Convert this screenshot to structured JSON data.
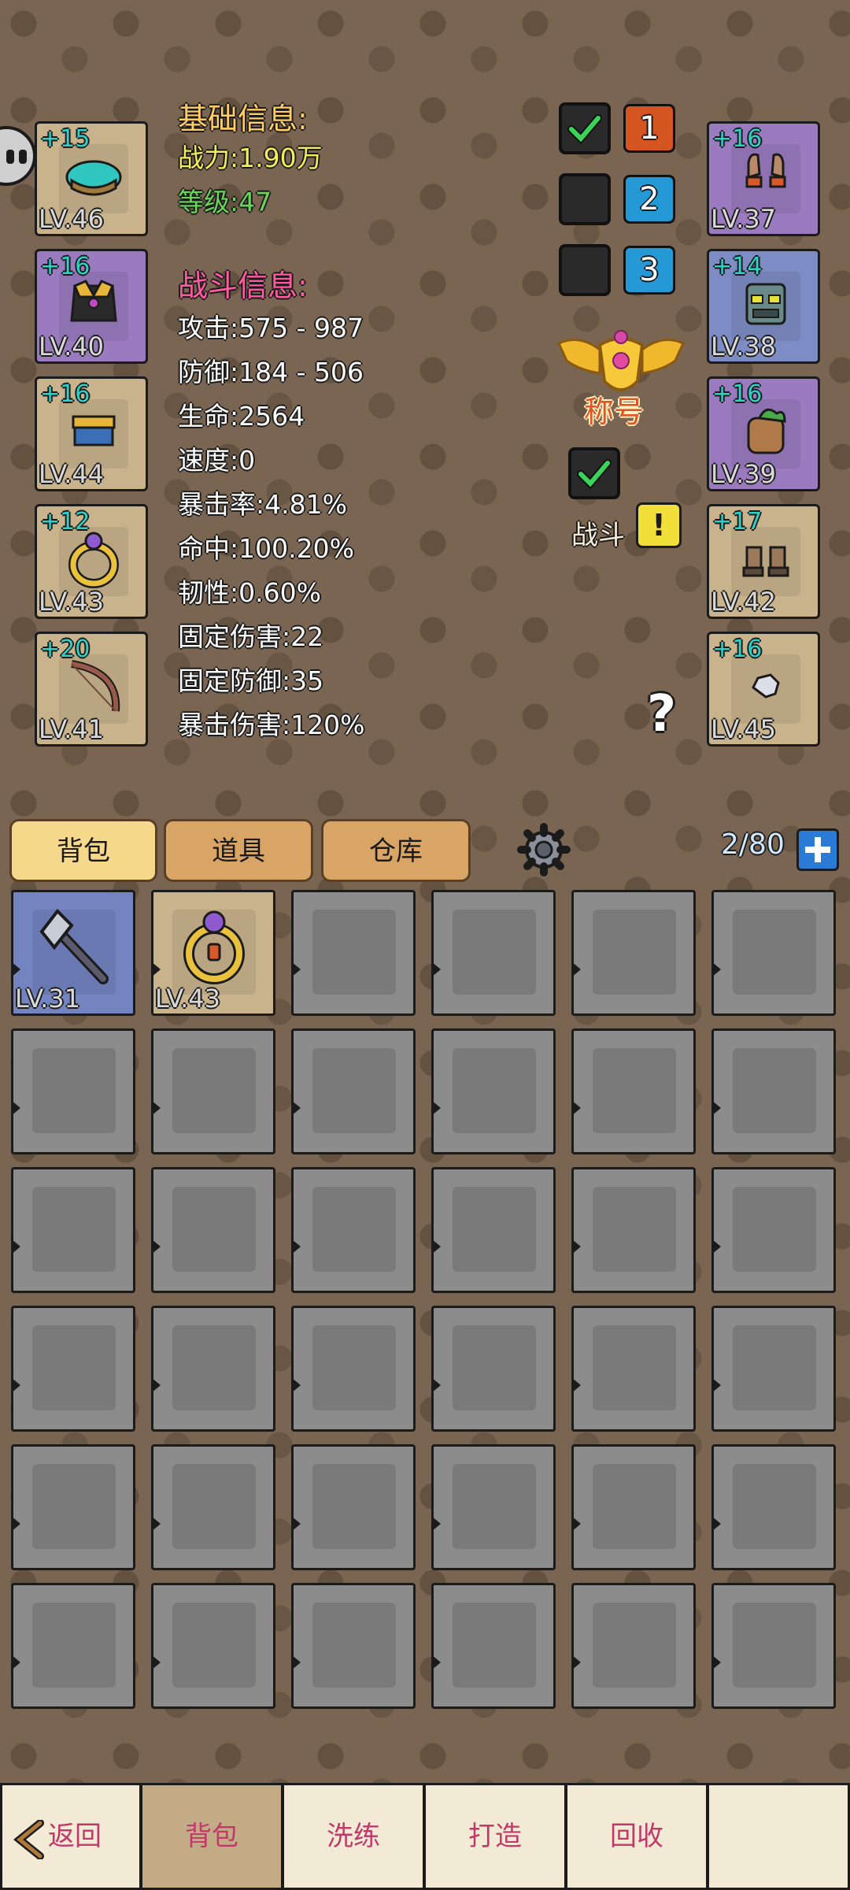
{
  "equipment_left": [
    {
      "plus": "+15",
      "level": "LV.46",
      "rarity": "tan",
      "icon": "helmet-icon"
    },
    {
      "plus": "+16",
      "level": "LV.40",
      "rarity": "purple",
      "icon": "armor-icon"
    },
    {
      "plus": "+16",
      "level": "LV.44",
      "rarity": "tan",
      "icon": "pants-icon"
    },
    {
      "plus": "+12",
      "level": "LV.43",
      "rarity": "tan",
      "icon": "ring-icon"
    },
    {
      "plus": "+20",
      "level": "LV.41",
      "rarity": "tan",
      "icon": "bow-icon"
    }
  ],
  "equipment_right": [
    {
      "plus": "+16",
      "level": "LV.37",
      "rarity": "purple",
      "icon": "gloves-icon"
    },
    {
      "plus": "+14",
      "level": "LV.38",
      "rarity": "blue",
      "icon": "mask-icon"
    },
    {
      "plus": "+16",
      "level": "LV.39",
      "rarity": "purple",
      "icon": "backpack-icon"
    },
    {
      "plus": "+17",
      "level": "LV.42",
      "rarity": "tan",
      "icon": "boots-icon"
    },
    {
      "plus": "+16",
      "level": "LV.45",
      "rarity": "tan",
      "icon": "gem-icon"
    }
  ],
  "basic_info": {
    "heading": "基础信息:",
    "power": "战力:1.90万",
    "level": "等级:47"
  },
  "battle_info": {
    "heading": "战斗信息:",
    "stats": [
      "攻击:575 - 987",
      "防御:184 - 506",
      "生命:2564",
      "速度:0",
      "暴击率:4.81%",
      "命中:100.20%",
      "韧性:0.60%",
      "固定伤害:22",
      "固定防御:35",
      "暴击伤害:120%"
    ]
  },
  "loadouts": [
    {
      "number": "1",
      "checked": true,
      "color": "orange"
    },
    {
      "number": "2",
      "checked": false,
      "color": "blue"
    },
    {
      "number": "3",
      "checked": false,
      "color": "blue"
    }
  ],
  "title_badge": {
    "label": "称号"
  },
  "battle_toggle": {
    "label": "战斗",
    "checked": true,
    "alert": "!"
  },
  "help": {
    "label": "?"
  },
  "tabs": {
    "bag": "背包",
    "items": "道具",
    "warehouse": "仓库"
  },
  "capacity": "2/80",
  "bag_items": [
    {
      "level": "LV.31",
      "rarity": "blue",
      "icon": "axe-icon"
    },
    {
      "level": "LV.43",
      "rarity": "tan",
      "icon": "ring-icon"
    }
  ],
  "bottom_nav": {
    "back": "返回",
    "bag": "背包",
    "refine": "洗练",
    "forge": "打造",
    "recycle": "回收"
  },
  "colors": {
    "accent_pink": "#c0396a",
    "stat_white": "#ffffff",
    "heading_orange": "#ffcc66",
    "heading_pink": "#ff5aa0"
  }
}
